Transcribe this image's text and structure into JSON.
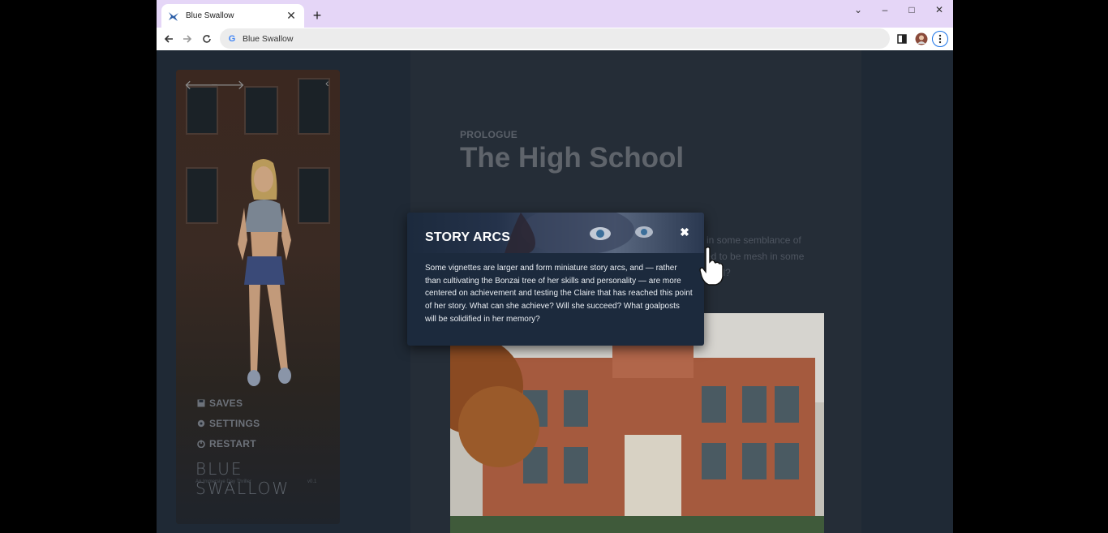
{
  "browser": {
    "tab_title": "Blue Swallow",
    "address": "Blue Swallow",
    "new_tab_symbol": "+",
    "tab_close_symbol": "✕",
    "window_controls": [
      "⌄",
      "–",
      "□",
      "✕"
    ]
  },
  "sidebar": {
    "menu": [
      {
        "label": "SAVES",
        "icon": "save-icon"
      },
      {
        "label": "SETTINGS",
        "icon": "gear-icon"
      },
      {
        "label": "RESTART",
        "icon": "power-icon"
      }
    ],
    "logo": "BLUE SWALLOW",
    "logo_sub": "An Immersive Day Thriller",
    "version": "v0.1"
  },
  "content": {
    "chapter": "PROLOGUE",
    "title": "The High School",
    "para_line1": "in some semblance of",
    "para_line2": "ed to be mesh in some",
    "para_line3": "ool?"
  },
  "modal": {
    "title": "STORY ARCS",
    "close_symbol": "✖",
    "body": "Some vignettes are larger and form miniature story arcs, and — rather than cultivating the Bonzai tree of her skills and personality — are more centered on achievement and testing the Claire that has reached this point of her story. What can she achieve? Will she succeed? What goalposts will be solidified in her memory?"
  },
  "colors": {
    "tab_strip": "#e5d6f7",
    "page_bg": "#1f2935",
    "modal_bg": "#1c2a3d",
    "accent": "#1a73e8"
  }
}
